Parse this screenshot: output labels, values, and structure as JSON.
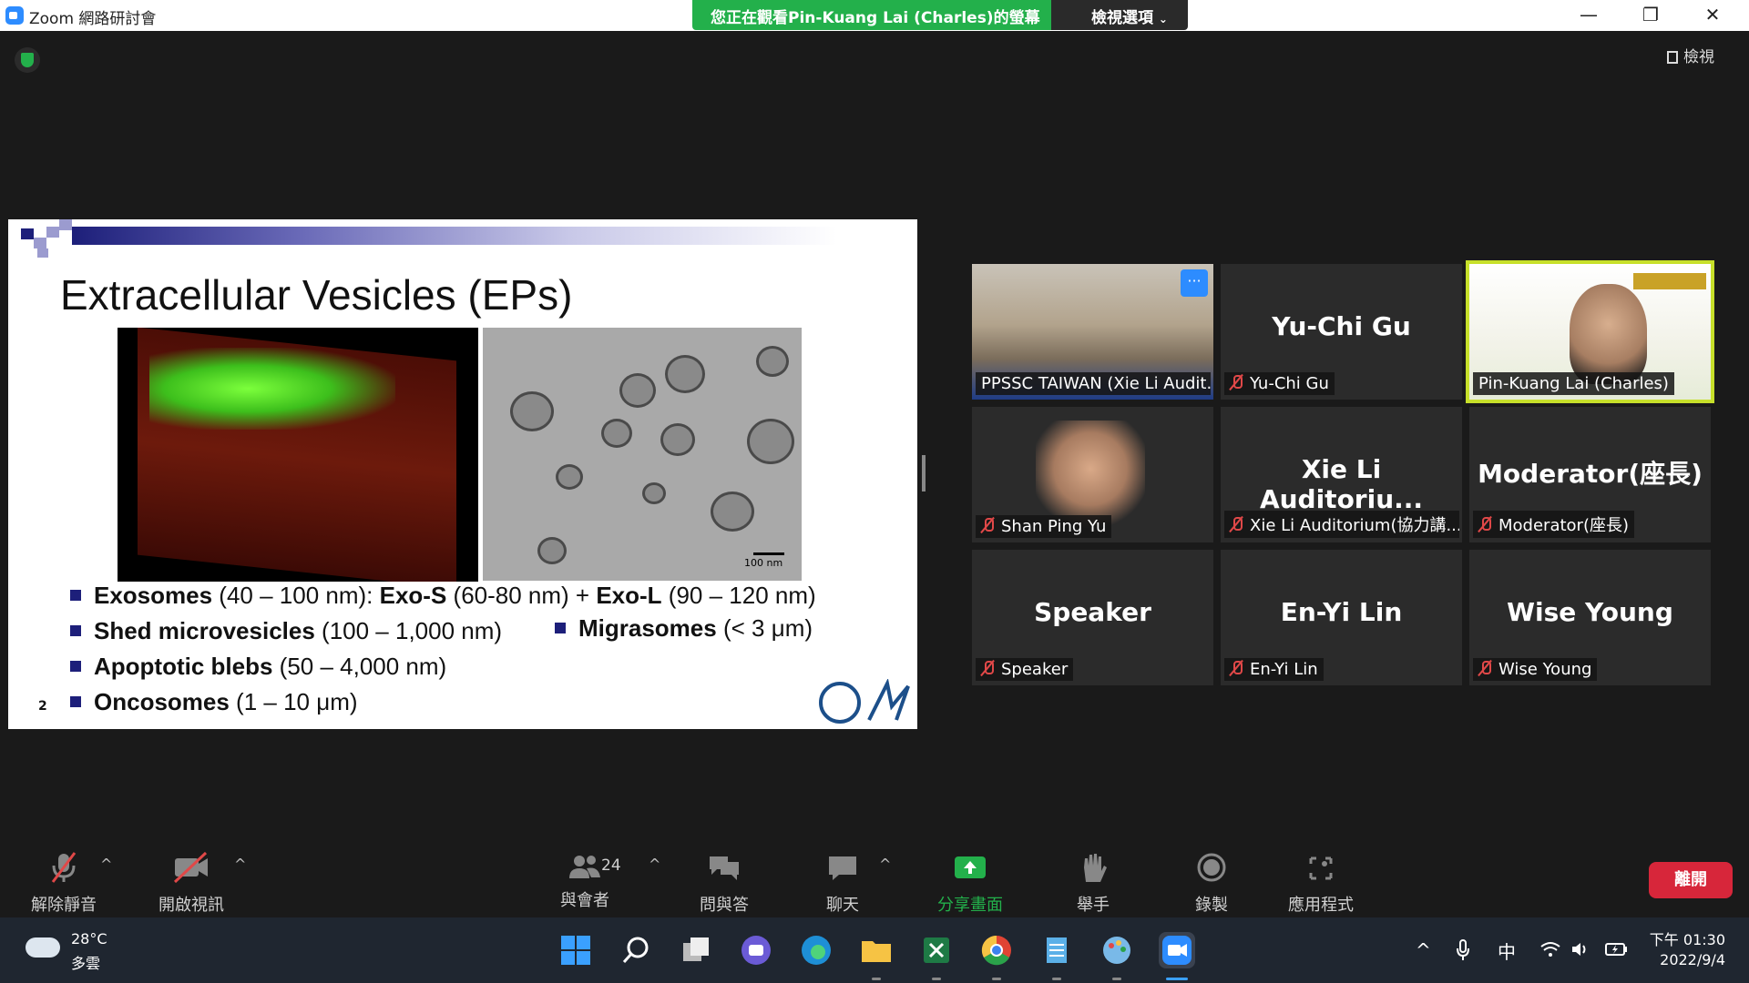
{
  "window": {
    "app_title": "Zoom 網路研討會",
    "viewing_banner": "您正在觀看Pin-Kuang Lai (Charles)的螢幕",
    "view_options_label": "檢視選項",
    "view_button_label": "檢視"
  },
  "slide": {
    "title": "Extracellular Vesicles (EPs)",
    "scale_bar_label": "100 nm",
    "slide_number": "2",
    "bullets": [
      {
        "bold": "Exosomes",
        "text": " (40 – 100 nm): ",
        "bold2": "Exo-S",
        "text2": " (60-80 nm) + ",
        "bold3": "Exo-L",
        "text3": " (90 – 120 nm)"
      },
      {
        "bold": "Shed microvesicles",
        "text": " (100 – 1,000 nm)"
      },
      {
        "bold": "Migrasomes",
        "text": " (< 3 μm)"
      },
      {
        "bold": "Apoptotic blebs",
        "text": " (50 – 4,000 nm)"
      },
      {
        "bold": "Oncosomes",
        "text": " (1 – 10 μm)"
      }
    ]
  },
  "participants": [
    {
      "display_name": "",
      "label": "PPSSC TAIWAN (Xie Li Audit...",
      "muted": false,
      "video": "room"
    },
    {
      "display_name": "Yu-Chi Gu",
      "label": "Yu-Chi Gu",
      "muted": true,
      "video": "none"
    },
    {
      "display_name": "",
      "label": "Pin-Kuang Lai (Charles)",
      "muted": false,
      "video": "speaker"
    },
    {
      "display_name": "",
      "label": "Shan Ping Yu",
      "muted": true,
      "video": "photo"
    },
    {
      "display_name": "Xie Li Auditoriu...",
      "label": "Xie Li Auditorium(協力講...",
      "muted": true,
      "video": "none"
    },
    {
      "display_name": "Moderator(座長)",
      "label": "Moderator(座長)",
      "muted": true,
      "video": "none"
    },
    {
      "display_name": "Speaker",
      "label": "Speaker",
      "muted": true,
      "video": "none"
    },
    {
      "display_name": "En-Yi Lin",
      "label": "En-Yi Lin",
      "muted": true,
      "video": "none"
    },
    {
      "display_name": "Wise Young",
      "label": "Wise Young",
      "muted": true,
      "video": "none"
    }
  ],
  "toolbar": {
    "unmute": "解除靜音",
    "start_video": "開啟視訊",
    "participants": "與會者",
    "participants_count": "24",
    "qa": "問與答",
    "chat": "聊天",
    "share_screen": "分享畫面",
    "raise_hand": "舉手",
    "record": "錄製",
    "apps": "應用程式",
    "leave": "離開"
  },
  "taskbar": {
    "temperature": "28°C",
    "weather": "多雲",
    "ime": "中",
    "time": "下午 01:30",
    "date": "2022/9/4"
  },
  "colors": {
    "accent_green": "#23b04b",
    "zoom_blue": "#2d8cff",
    "leave_red": "#d7263a",
    "active_speaker": "#c7e02a"
  }
}
